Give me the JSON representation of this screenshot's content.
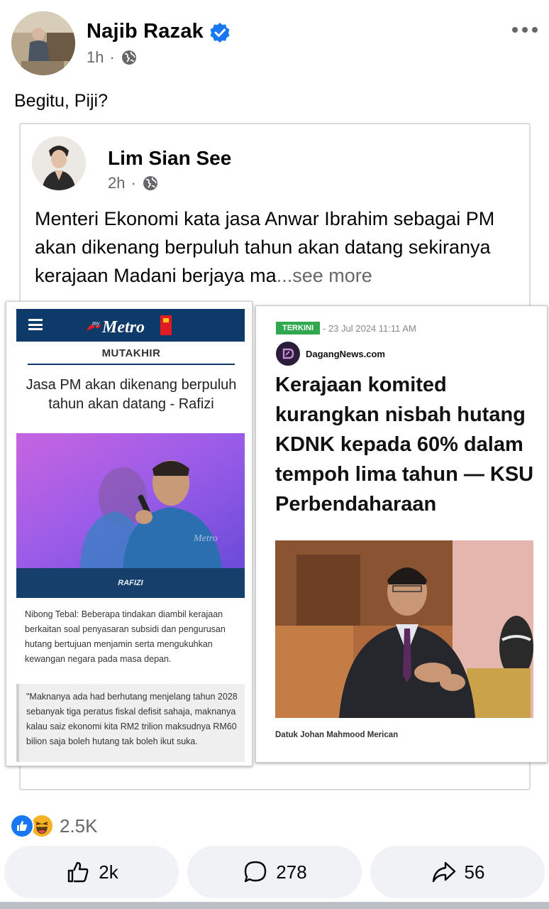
{
  "post": {
    "author": "Najib Razak",
    "time": "1h",
    "separator": "·",
    "text": "Begitu, Piji?",
    "icons": {
      "verified": "verified-badge-icon",
      "audience": "globe-icon",
      "menu": "more-options-icon"
    }
  },
  "shared_post": {
    "author": "Lim Sian See",
    "time": "2h",
    "separator": "·",
    "text": "Menteri Ekonomi kata jasa Anwar Ibrahim sebagai PM akan dikenang berpuluh tahun akan datang sekiranya kerajaan Madani berjaya ma",
    "see_more": "...see more"
  },
  "metro_clip": {
    "logo_prefix": "my",
    "logo_text": "Metro",
    "section": "MUTAKHIR",
    "headline": "Jasa PM akan dikenang berpuluh tahun akan datang - Rafizi",
    "photo_watermark": "Metro",
    "photo_caption": "RAFIZI",
    "body": "Nibong Tebal: Beberapa tindakan diambil kerajaan berkaitan soal penyasaran subsidi dan pengurusan hutang bertujuan menjamin serta mengukuhkan kewangan negara pada masa depan.",
    "quote": "\"Maknanya ada had berhutang menjelang tahun 2028 sebanyak tiga peratus fiskal defisit sahaja, maknanya kalau saiz ekonomi kita RM2 trilion maksudnya RM60 bilion saja boleh hutang tak boleh ikut suka."
  },
  "dagang_clip": {
    "badge": "TERKINI",
    "date": "- 23 Jul 2024 11:11 AM",
    "source": "DagangNews.com",
    "headline": "Kerajaan komited kurangkan nisbah hutang KDNK kepada 60% dalam tempoh lima tahun — KSU Perbendaharaan",
    "photo_caption": "Datuk Johan Mahmood Merican"
  },
  "reactions": {
    "count": "2.5K",
    "types": [
      "like-icon",
      "haha-icon"
    ]
  },
  "actions": {
    "like": "2k",
    "comment": "278",
    "share": "56"
  },
  "colors": {
    "accent": "#1877f2",
    "metro_navy": "#0e3a6a",
    "terkini_green": "#2fa84f",
    "muted": "#65676b"
  }
}
